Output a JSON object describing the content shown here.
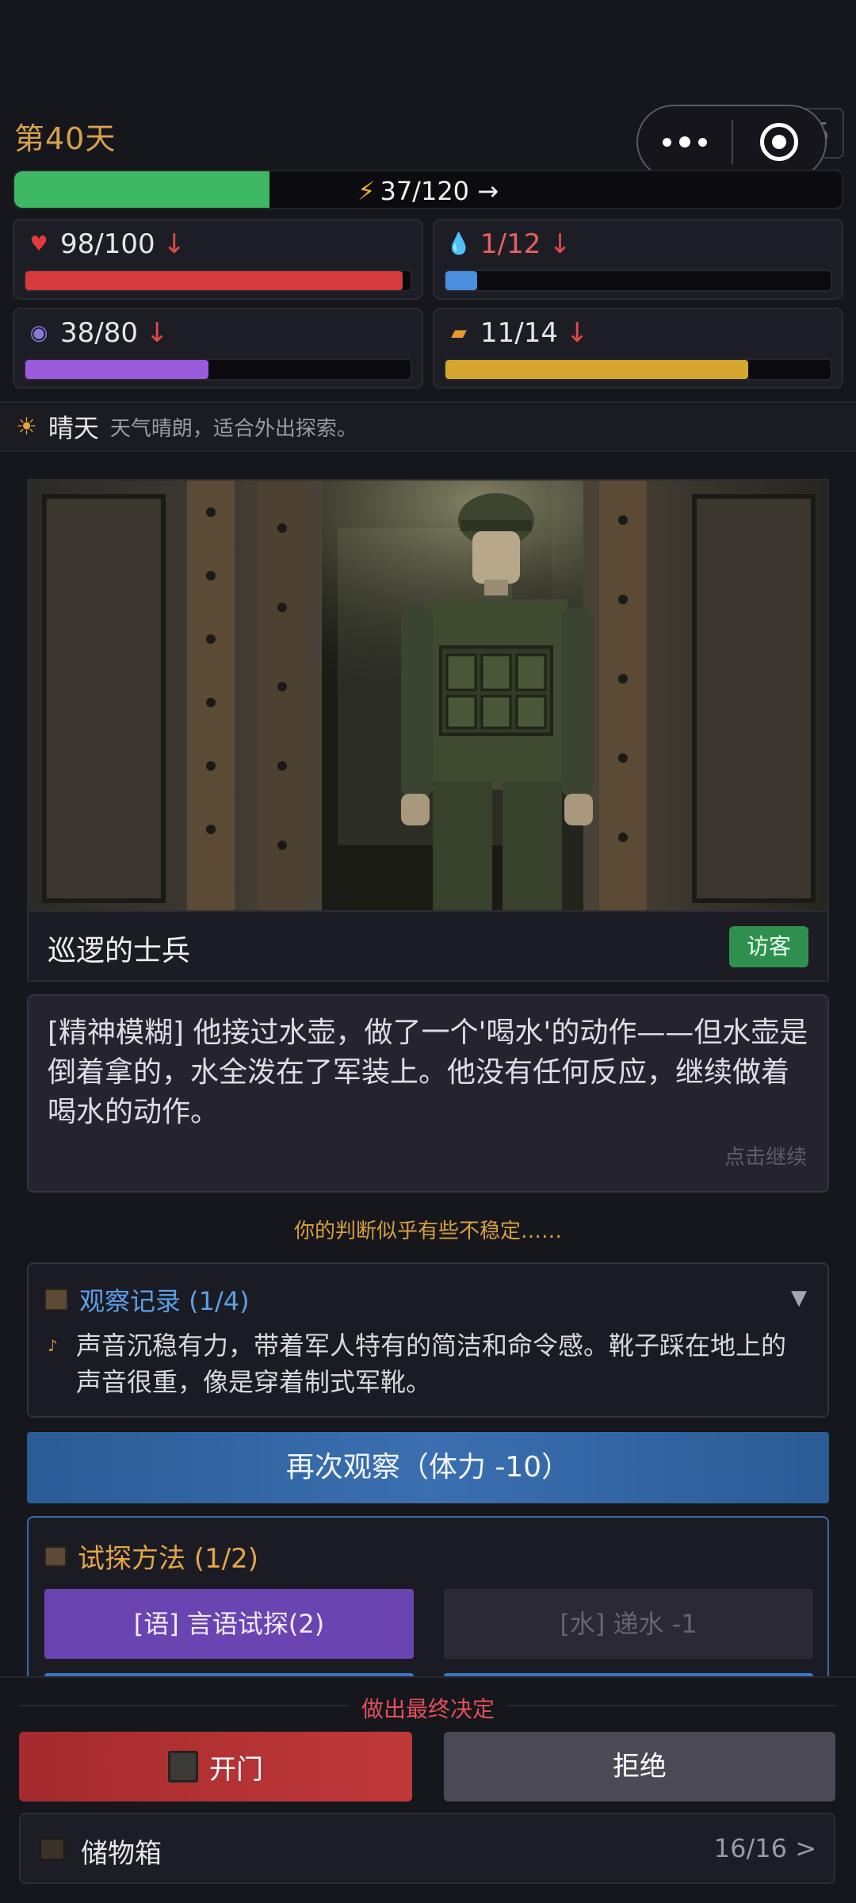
{
  "header": {
    "day": "第40天",
    "behind_badge": "/5"
  },
  "energy": {
    "text": "37/120 →",
    "icon": "lightning-icon",
    "value": 37,
    "max": 120,
    "color": "#3fb863"
  },
  "stats": {
    "health": {
      "text": "98/100",
      "arrow": "↓",
      "icon": "heart-icon",
      "value": 98,
      "max": 100,
      "color": "#d63a3a"
    },
    "water": {
      "text": "1/12",
      "arrow": "↓",
      "icon": "water-drop-icon",
      "value": 1,
      "max": 12,
      "color": "#4a8fde"
    },
    "mind": {
      "text": "38/80",
      "arrow": "↓",
      "icon": "brain-icon",
      "value": 38,
      "max": 80,
      "color": "#9a5bdc"
    },
    "food": {
      "text": "11/14",
      "arrow": "↓",
      "icon": "bread-icon",
      "value": 11,
      "max": 14,
      "color": "#d4a62f"
    }
  },
  "weather": {
    "name": "晴天",
    "desc": "天气晴朗，适合外出探索。",
    "icon": "sun-icon"
  },
  "visitor": {
    "name": "巡逻的士兵",
    "tag": "访客"
  },
  "dialog": {
    "text": "[精神模糊] 他接过水壶，做了一个'喝水'的动作——但水壶是倒着拿的，水全泼在了军装上。他没有任何反应，继续做着喝水的动作。",
    "continue": "点击继续"
  },
  "warning": "你的判断似乎有些不稳定……",
  "observation": {
    "title": "观察记录 (1/4)",
    "toggle": "▼",
    "item": "声音沉稳有力，带着军人特有的简洁和命令感。靴子踩在地上的声音很重，像是穿着制式军靴。"
  },
  "reobserve": "再次观察（体力 -10）",
  "probe": {
    "title": "试探方法 (1/2)",
    "talk": "[语] 言语试探(2)",
    "water": "[水] 递水 -1"
  },
  "decision": {
    "label": "做出最终决定",
    "open": "开门",
    "refuse": "拒绝"
  },
  "storage": {
    "label": "储物箱",
    "count": "16/16 >"
  }
}
